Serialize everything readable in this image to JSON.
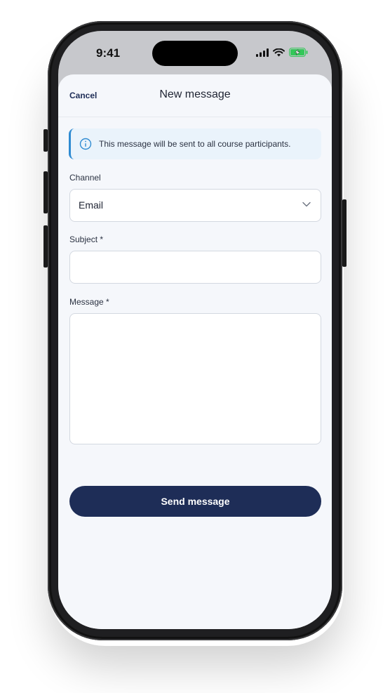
{
  "status_bar": {
    "time": "9:41"
  },
  "nav": {
    "cancel_label": "Cancel",
    "title": "New message"
  },
  "info_banner": {
    "text": "This message will be sent to all course participants.",
    "icon": "info-icon"
  },
  "form": {
    "channel_label": "Channel",
    "channel_value": "Email",
    "subject_label": "Subject *",
    "subject_value": "",
    "message_label": "Message *",
    "message_value": ""
  },
  "send_button_label": "Send message",
  "colors": {
    "primary": "#1e2d57",
    "info_accent": "#2f8bd2",
    "info_bg": "#eaf3fb",
    "battery": "#34c759"
  }
}
